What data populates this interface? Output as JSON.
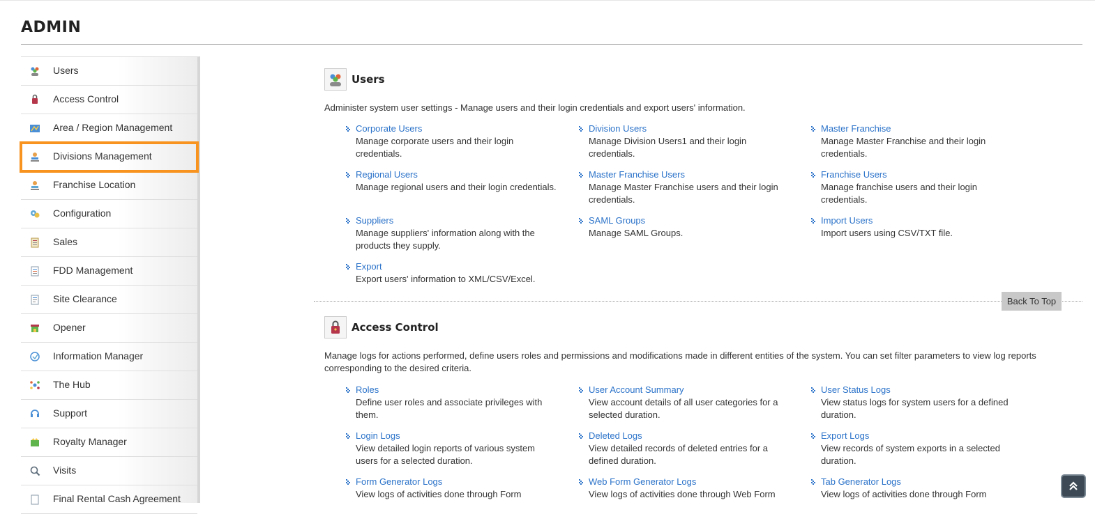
{
  "page": {
    "title": "ADMIN"
  },
  "sidebar": {
    "items": [
      {
        "label": "Users",
        "icon": "users-icon"
      },
      {
        "label": "Access Control",
        "icon": "access-control-icon"
      },
      {
        "label": "Area / Region Management",
        "icon": "map-icon"
      },
      {
        "label": "Divisions Management",
        "icon": "divisions-icon",
        "active": true
      },
      {
        "label": "Franchise Location",
        "icon": "location-icon"
      },
      {
        "label": "Configuration",
        "icon": "gears-icon"
      },
      {
        "label": "Sales",
        "icon": "sales-icon"
      },
      {
        "label": "FDD Management",
        "icon": "document-icon"
      },
      {
        "label": "Site Clearance",
        "icon": "clearance-icon"
      },
      {
        "label": "Opener",
        "icon": "store-icon"
      },
      {
        "label": "Information Manager",
        "icon": "info-manager-icon"
      },
      {
        "label": "The Hub",
        "icon": "hub-icon"
      },
      {
        "label": "Support",
        "icon": "support-icon"
      },
      {
        "label": "Royalty Manager",
        "icon": "royalty-icon"
      },
      {
        "label": "Visits",
        "icon": "visits-icon"
      },
      {
        "label": "Final Rental Cash Agreement",
        "icon": "agreement-icon"
      }
    ]
  },
  "sections": {
    "users": {
      "title": "Users",
      "icon": "users-icon",
      "description": "Administer system user settings - Manage users and their login credentials and export users' information.",
      "links": [
        {
          "title": "Corporate Users",
          "desc": "Manage corporate users and their login credentials."
        },
        {
          "title": "Division Users",
          "desc": "Manage Division Users1 and their login credentials."
        },
        {
          "title": "Master Franchise",
          "desc": "Manage Master Franchise and their login credentials."
        },
        {
          "title": "Regional Users",
          "desc": "Manage regional users and their login credentials."
        },
        {
          "title": "Master Franchise Users",
          "desc": "Manage Master Franchise users and their login credentials."
        },
        {
          "title": "Franchise Users",
          "desc": "Manage franchise users and their login credentials."
        },
        {
          "title": "Suppliers",
          "desc": "Manage suppliers' information along with the products they supply."
        },
        {
          "title": "SAML Groups",
          "desc": "Manage SAML Groups."
        },
        {
          "title": "Import Users",
          "desc": "Import users using CSV/TXT file."
        },
        {
          "title": "Export",
          "desc": "Export users' information to XML/CSV/Excel."
        }
      ]
    },
    "access_control": {
      "title": "Access Control",
      "icon": "access-control-icon",
      "description": "Manage logs for actions performed, define users roles and permissions and modifications made in different entities of the system. You can set filter parameters to view log reports corresponding to the desired criteria.",
      "links": [
        {
          "title": "Roles",
          "desc": "Define user roles and associate privileges with them."
        },
        {
          "title": "User Account Summary",
          "desc": "View account details of all user categories for a selected duration."
        },
        {
          "title": "User Status Logs",
          "desc": "View status logs for system users for a defined duration."
        },
        {
          "title": "Login Logs",
          "desc": "View detailed login reports of various system users for a selected duration."
        },
        {
          "title": "Deleted Logs",
          "desc": "View detailed records of deleted entries for a defined duration."
        },
        {
          "title": "Export Logs",
          "desc": "View records of system exports in a selected duration."
        },
        {
          "title": "Form Generator Logs",
          "desc": "View logs of activities done through Form"
        },
        {
          "title": "Web Form Generator Logs",
          "desc": "View logs of activities done through Web Form"
        },
        {
          "title": "Tab Generator Logs",
          "desc": "View logs of activities done through Form"
        }
      ]
    }
  },
  "back_to_top": {
    "label": "Back To Top"
  },
  "colors": {
    "link": "#2a72c9",
    "active_outline": "#f7931e",
    "back_top_bg": "#c8c8c8"
  }
}
